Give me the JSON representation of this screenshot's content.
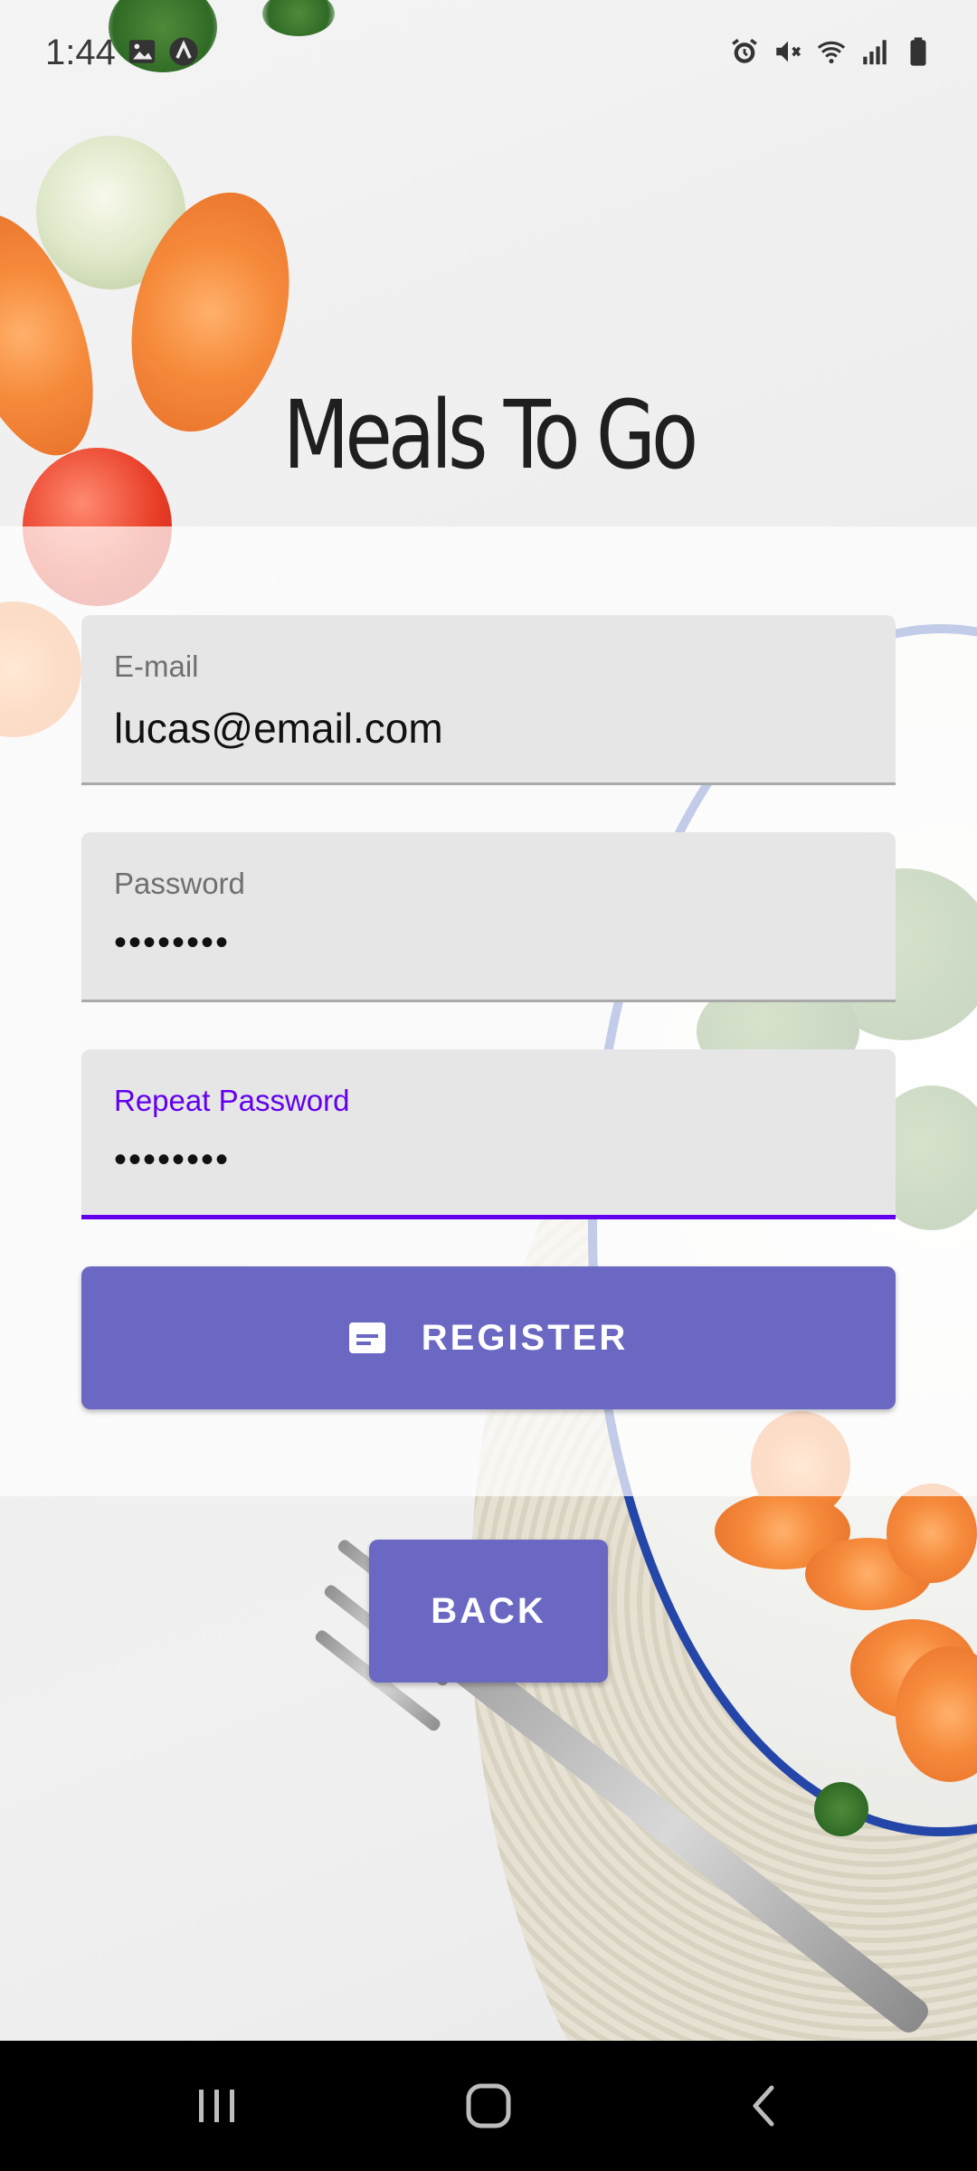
{
  "status_bar": {
    "time": "1:44",
    "left_icons": [
      "image-icon",
      "app-icon"
    ],
    "right_icons": [
      "alarm-icon",
      "mute-icon",
      "wifi-icon",
      "signal-icon",
      "battery-icon"
    ]
  },
  "app": {
    "title": "Meals To Go"
  },
  "form": {
    "email": {
      "label": "E-mail",
      "value": "lucas@email.com"
    },
    "password": {
      "label": "Password",
      "value": "••••••••"
    },
    "repeat_password": {
      "label": "Repeat Password",
      "value": "••••••••"
    },
    "register_label": "REGISTER",
    "register_icon": "card-icon"
  },
  "back_label": "BACK",
  "nav": {
    "buttons": [
      "recent-apps-icon",
      "home-icon",
      "back-icon"
    ]
  },
  "colors": {
    "accent": "#6a68c2",
    "focus": "#6200ee",
    "field_bg": "#e6e6e6"
  }
}
